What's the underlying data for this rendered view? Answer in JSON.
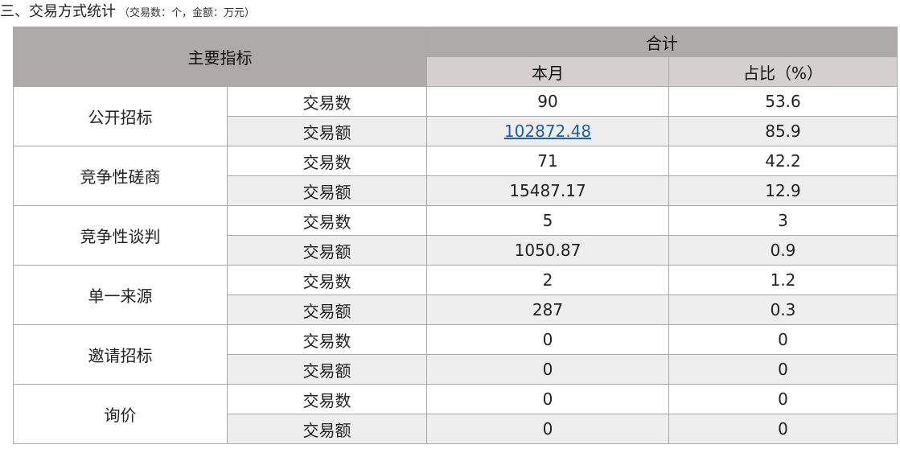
{
  "section": {
    "title": "三、交易方式统计",
    "note": "（交易数：个，金额：万元）"
  },
  "table": {
    "header_main": "主要指标",
    "header_total": "合计",
    "header_month": "本月",
    "header_ratio": "占比（%）",
    "rows": [
      {
        "method": "公开招标",
        "count_label": "交易数",
        "count_value": "90",
        "count_ratio": "53.6",
        "amount_label": "交易额",
        "amount_value": "102872.48",
        "amount_ratio": "85.9"
      },
      {
        "method": "竞争性磋商",
        "count_label": "交易数",
        "count_value": "71",
        "count_ratio": "42.2",
        "amount_label": "交易额",
        "amount_value": "15487.17",
        "amount_ratio": "12.9"
      },
      {
        "method": "竞争性谈判",
        "count_label": "交易数",
        "count_value": "5",
        "count_ratio": "3",
        "amount_label": "交易额",
        "amount_value": "1050.87",
        "amount_ratio": "0.9"
      },
      {
        "method": "单一来源",
        "count_label": "交易数",
        "count_value": "2",
        "count_ratio": "1.2",
        "amount_label": "交易额",
        "amount_value": "287",
        "amount_ratio": "0.3"
      },
      {
        "method": "邀请招标",
        "count_label": "交易数",
        "count_value": "0",
        "count_ratio": "0",
        "amount_label": "交易额",
        "amount_value": "0",
        "amount_ratio": "0"
      },
      {
        "method": "询价",
        "count_label": "交易数",
        "count_value": "0",
        "count_ratio": "0",
        "amount_label": "交易额",
        "amount_value": "0",
        "amount_ratio": "0"
      }
    ]
  }
}
